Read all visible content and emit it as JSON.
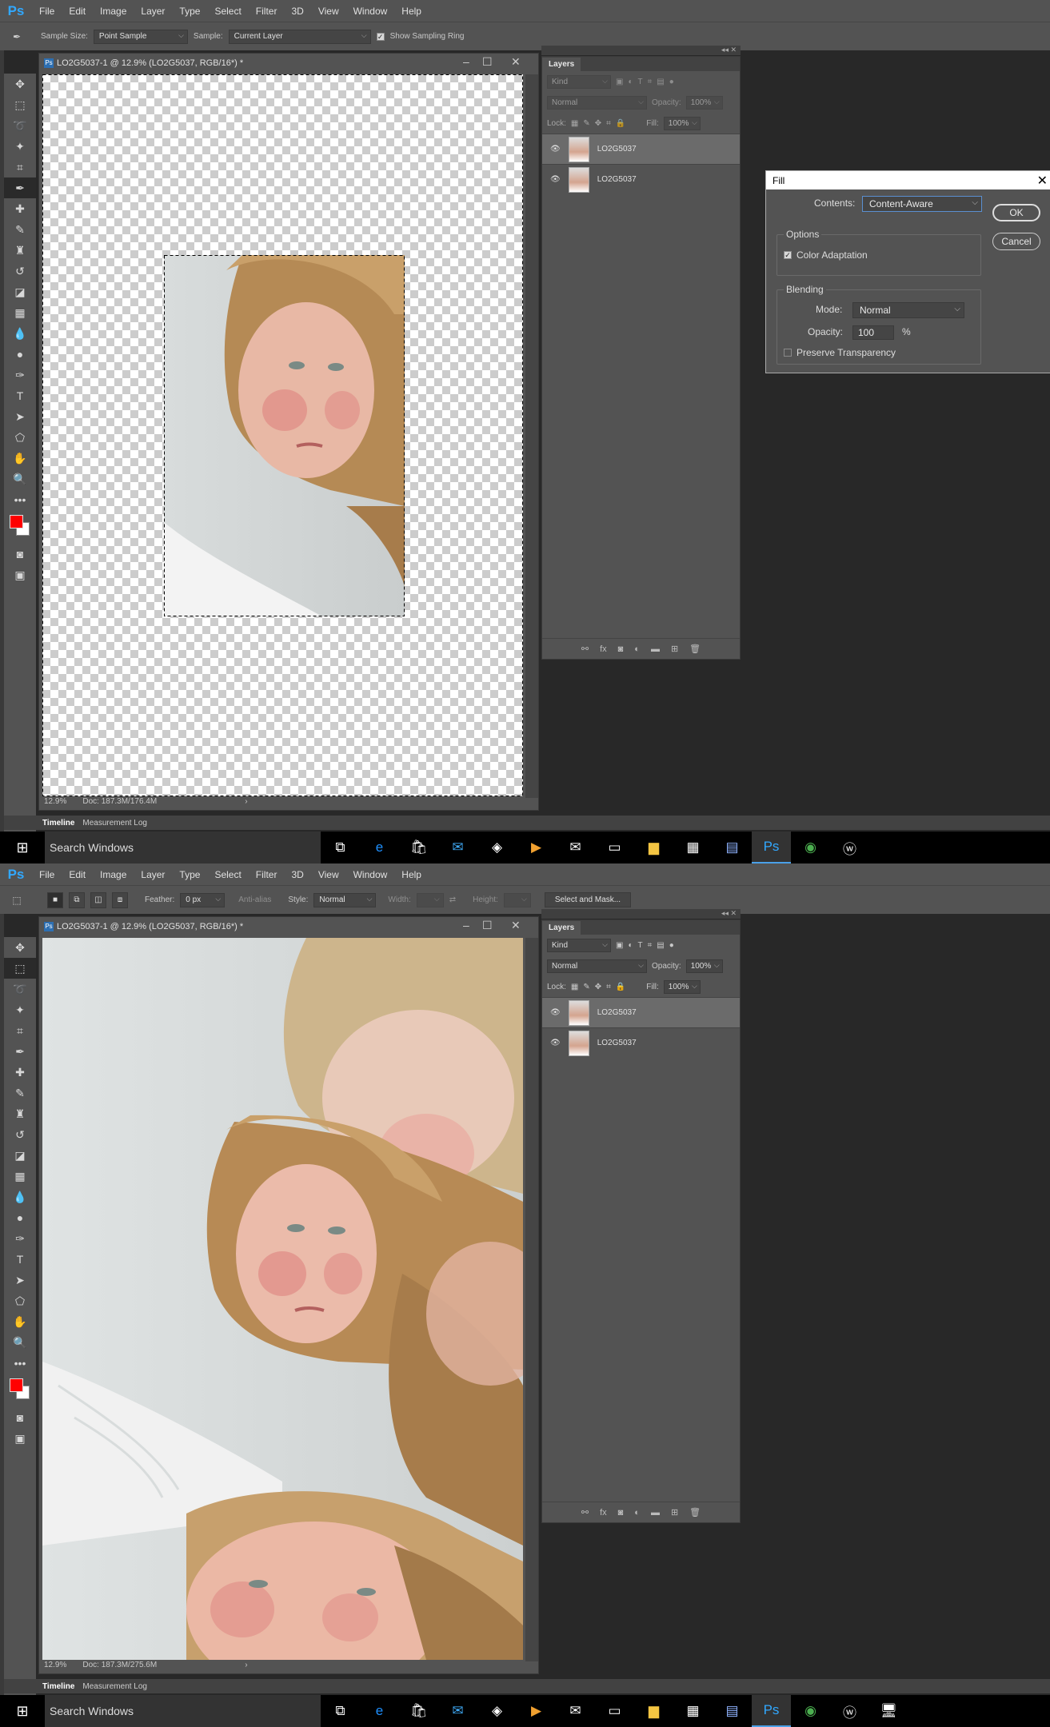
{
  "menu": [
    "File",
    "Edit",
    "Image",
    "Layer",
    "Type",
    "Select",
    "Filter",
    "3D",
    "View",
    "Window",
    "Help"
  ],
  "app_logo": "Ps",
  "screen1": {
    "options": {
      "sample_size_label": "Sample Size:",
      "sample_size_value": "Point Sample",
      "sample_label": "Sample:",
      "sample_value": "Current Layer",
      "sampling_ring_label": "Show Sampling Ring",
      "sampling_ring_checked": true
    },
    "doc_title": "LO2G5037-1 @ 12.9% (LO2G5037, RGB/16*) *",
    "zoom": "12.9%",
    "doc_info": "Doc: 187.3M/176.4M",
    "layers_panel": {
      "tab": "Layers",
      "kind": "Kind",
      "blend": "Normal",
      "opacity_label": "Opacity:",
      "opacity": "100%",
      "lock_label": "Lock:",
      "fill_label": "Fill:",
      "fill": "100%",
      "layers": [
        {
          "name": "LO2G5037",
          "selected": true
        },
        {
          "name": "LO2G5037",
          "selected": false
        }
      ]
    },
    "fill_dialog": {
      "title": "Fill",
      "contents_label": "Contents:",
      "contents_value": "Content-Aware",
      "ok": "OK",
      "cancel": "Cancel",
      "options_legend": "Options",
      "color_adaptation": "Color Adaptation",
      "color_adaptation_checked": true,
      "blending_legend": "Blending",
      "mode_label": "Mode:",
      "mode_value": "Normal",
      "opacity_label": "Opacity:",
      "opacity_value": "100",
      "opacity_unit": "%",
      "preserve_transparency": "Preserve Transparency",
      "preserve_transparency_checked": false
    }
  },
  "screen2": {
    "options": {
      "feather_label": "Feather:",
      "feather_value": "0 px",
      "anti_alias": "Anti-alias",
      "style_label": "Style:",
      "style_value": "Normal",
      "width_label": "Width:",
      "height_label": "Height:",
      "select_mask": "Select and Mask..."
    },
    "doc_title": "LO2G5037-1 @ 12.9% (LO2G5037, RGB/16*) *",
    "zoom": "12.9%",
    "doc_info": "Doc: 187.3M/275.6M",
    "layers_panel": {
      "tab": "Layers",
      "kind": "Kind",
      "blend": "Normal",
      "opacity_label": "Opacity:",
      "opacity": "100%",
      "lock_label": "Lock:",
      "fill_label": "Fill:",
      "fill": "100%",
      "layers": [
        {
          "name": "LO2G5037",
          "selected": true
        },
        {
          "name": "LO2G5037",
          "selected": false
        }
      ]
    }
  },
  "bottom_tabs": [
    "Timeline",
    "Measurement Log"
  ],
  "taskbar": {
    "search_placeholder": "Search Windows",
    "apps": [
      "task-view-icon",
      "edge-icon",
      "store-icon",
      "mail-app-icon",
      "app-icon",
      "media-player-icon",
      "mail-icon",
      "terminal-icon",
      "file-explorer-icon",
      "calculator-icon",
      "notes-icon",
      "photoshop-icon",
      "chrome-icon",
      "wamp-icon"
    ]
  },
  "colors": {
    "foreground": "#ff0000",
    "background": "#ffffff",
    "accent": "#31a8ff"
  }
}
